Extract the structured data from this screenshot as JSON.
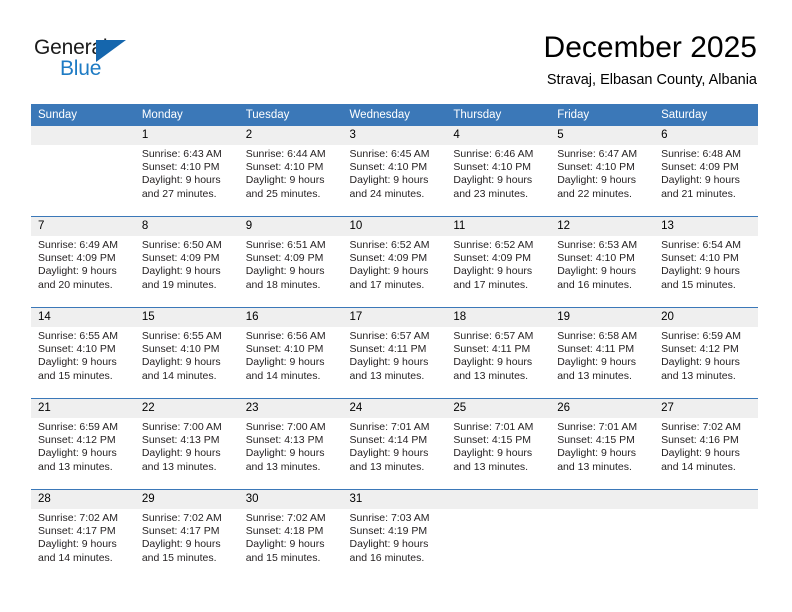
{
  "brand": {
    "name_part1": "General",
    "name_part2": "Blue",
    "triangle_icon": "triangle-icon",
    "accent_color": "#1e7bc4",
    "dark_color": "#1566ad"
  },
  "header": {
    "month_title": "December 2025",
    "location": "Stravaj, Elbasan County, Albania"
  },
  "theme": {
    "header_blue": "#3b78b8",
    "daynum_gray": "#efefef",
    "text_color": "#231f20"
  },
  "weekday_headers": [
    "Sunday",
    "Monday",
    "Tuesday",
    "Wednesday",
    "Thursday",
    "Friday",
    "Saturday"
  ],
  "weeks": [
    [
      {
        "day": "",
        "lines": [
          "",
          "",
          "",
          ""
        ]
      },
      {
        "day": "1",
        "lines": [
          "Sunrise: 6:43 AM",
          "Sunset: 4:10 PM",
          "Daylight: 9 hours",
          "and 27 minutes."
        ]
      },
      {
        "day": "2",
        "lines": [
          "Sunrise: 6:44 AM",
          "Sunset: 4:10 PM",
          "Daylight: 9 hours",
          "and 25 minutes."
        ]
      },
      {
        "day": "3",
        "lines": [
          "Sunrise: 6:45 AM",
          "Sunset: 4:10 PM",
          "Daylight: 9 hours",
          "and 24 minutes."
        ]
      },
      {
        "day": "4",
        "lines": [
          "Sunrise: 6:46 AM",
          "Sunset: 4:10 PM",
          "Daylight: 9 hours",
          "and 23 minutes."
        ]
      },
      {
        "day": "5",
        "lines": [
          "Sunrise: 6:47 AM",
          "Sunset: 4:10 PM",
          "Daylight: 9 hours",
          "and 22 minutes."
        ]
      },
      {
        "day": "6",
        "lines": [
          "Sunrise: 6:48 AM",
          "Sunset: 4:09 PM",
          "Daylight: 9 hours",
          "and 21 minutes."
        ]
      }
    ],
    [
      {
        "day": "7",
        "lines": [
          "Sunrise: 6:49 AM",
          "Sunset: 4:09 PM",
          "Daylight: 9 hours",
          "and 20 minutes."
        ]
      },
      {
        "day": "8",
        "lines": [
          "Sunrise: 6:50 AM",
          "Sunset: 4:09 PM",
          "Daylight: 9 hours",
          "and 19 minutes."
        ]
      },
      {
        "day": "9",
        "lines": [
          "Sunrise: 6:51 AM",
          "Sunset: 4:09 PM",
          "Daylight: 9 hours",
          "and 18 minutes."
        ]
      },
      {
        "day": "10",
        "lines": [
          "Sunrise: 6:52 AM",
          "Sunset: 4:09 PM",
          "Daylight: 9 hours",
          "and 17 minutes."
        ]
      },
      {
        "day": "11",
        "lines": [
          "Sunrise: 6:52 AM",
          "Sunset: 4:09 PM",
          "Daylight: 9 hours",
          "and 17 minutes."
        ]
      },
      {
        "day": "12",
        "lines": [
          "Sunrise: 6:53 AM",
          "Sunset: 4:10 PM",
          "Daylight: 9 hours",
          "and 16 minutes."
        ]
      },
      {
        "day": "13",
        "lines": [
          "Sunrise: 6:54 AM",
          "Sunset: 4:10 PM",
          "Daylight: 9 hours",
          "and 15 minutes."
        ]
      }
    ],
    [
      {
        "day": "14",
        "lines": [
          "Sunrise: 6:55 AM",
          "Sunset: 4:10 PM",
          "Daylight: 9 hours",
          "and 15 minutes."
        ]
      },
      {
        "day": "15",
        "lines": [
          "Sunrise: 6:55 AM",
          "Sunset: 4:10 PM",
          "Daylight: 9 hours",
          "and 14 minutes."
        ]
      },
      {
        "day": "16",
        "lines": [
          "Sunrise: 6:56 AM",
          "Sunset: 4:10 PM",
          "Daylight: 9 hours",
          "and 14 minutes."
        ]
      },
      {
        "day": "17",
        "lines": [
          "Sunrise: 6:57 AM",
          "Sunset: 4:11 PM",
          "Daylight: 9 hours",
          "and 13 minutes."
        ]
      },
      {
        "day": "18",
        "lines": [
          "Sunrise: 6:57 AM",
          "Sunset: 4:11 PM",
          "Daylight: 9 hours",
          "and 13 minutes."
        ]
      },
      {
        "day": "19",
        "lines": [
          "Sunrise: 6:58 AM",
          "Sunset: 4:11 PM",
          "Daylight: 9 hours",
          "and 13 minutes."
        ]
      },
      {
        "day": "20",
        "lines": [
          "Sunrise: 6:59 AM",
          "Sunset: 4:12 PM",
          "Daylight: 9 hours",
          "and 13 minutes."
        ]
      }
    ],
    [
      {
        "day": "21",
        "lines": [
          "Sunrise: 6:59 AM",
          "Sunset: 4:12 PM",
          "Daylight: 9 hours",
          "and 13 minutes."
        ]
      },
      {
        "day": "22",
        "lines": [
          "Sunrise: 7:00 AM",
          "Sunset: 4:13 PM",
          "Daylight: 9 hours",
          "and 13 minutes."
        ]
      },
      {
        "day": "23",
        "lines": [
          "Sunrise: 7:00 AM",
          "Sunset: 4:13 PM",
          "Daylight: 9 hours",
          "and 13 minutes."
        ]
      },
      {
        "day": "24",
        "lines": [
          "Sunrise: 7:01 AM",
          "Sunset: 4:14 PM",
          "Daylight: 9 hours",
          "and 13 minutes."
        ]
      },
      {
        "day": "25",
        "lines": [
          "Sunrise: 7:01 AM",
          "Sunset: 4:15 PM",
          "Daylight: 9 hours",
          "and 13 minutes."
        ]
      },
      {
        "day": "26",
        "lines": [
          "Sunrise: 7:01 AM",
          "Sunset: 4:15 PM",
          "Daylight: 9 hours",
          "and 13 minutes."
        ]
      },
      {
        "day": "27",
        "lines": [
          "Sunrise: 7:02 AM",
          "Sunset: 4:16 PM",
          "Daylight: 9 hours",
          "and 14 minutes."
        ]
      }
    ],
    [
      {
        "day": "28",
        "lines": [
          "Sunrise: 7:02 AM",
          "Sunset: 4:17 PM",
          "Daylight: 9 hours",
          "and 14 minutes."
        ]
      },
      {
        "day": "29",
        "lines": [
          "Sunrise: 7:02 AM",
          "Sunset: 4:17 PM",
          "Daylight: 9 hours",
          "and 15 minutes."
        ]
      },
      {
        "day": "30",
        "lines": [
          "Sunrise: 7:02 AM",
          "Sunset: 4:18 PM",
          "Daylight: 9 hours",
          "and 15 minutes."
        ]
      },
      {
        "day": "31",
        "lines": [
          "Sunrise: 7:03 AM",
          "Sunset: 4:19 PM",
          "Daylight: 9 hours",
          "and 16 minutes."
        ]
      },
      {
        "day": "",
        "lines": [
          "",
          "",
          "",
          ""
        ]
      },
      {
        "day": "",
        "lines": [
          "",
          "",
          "",
          ""
        ]
      },
      {
        "day": "",
        "lines": [
          "",
          "",
          "",
          ""
        ]
      }
    ]
  ]
}
